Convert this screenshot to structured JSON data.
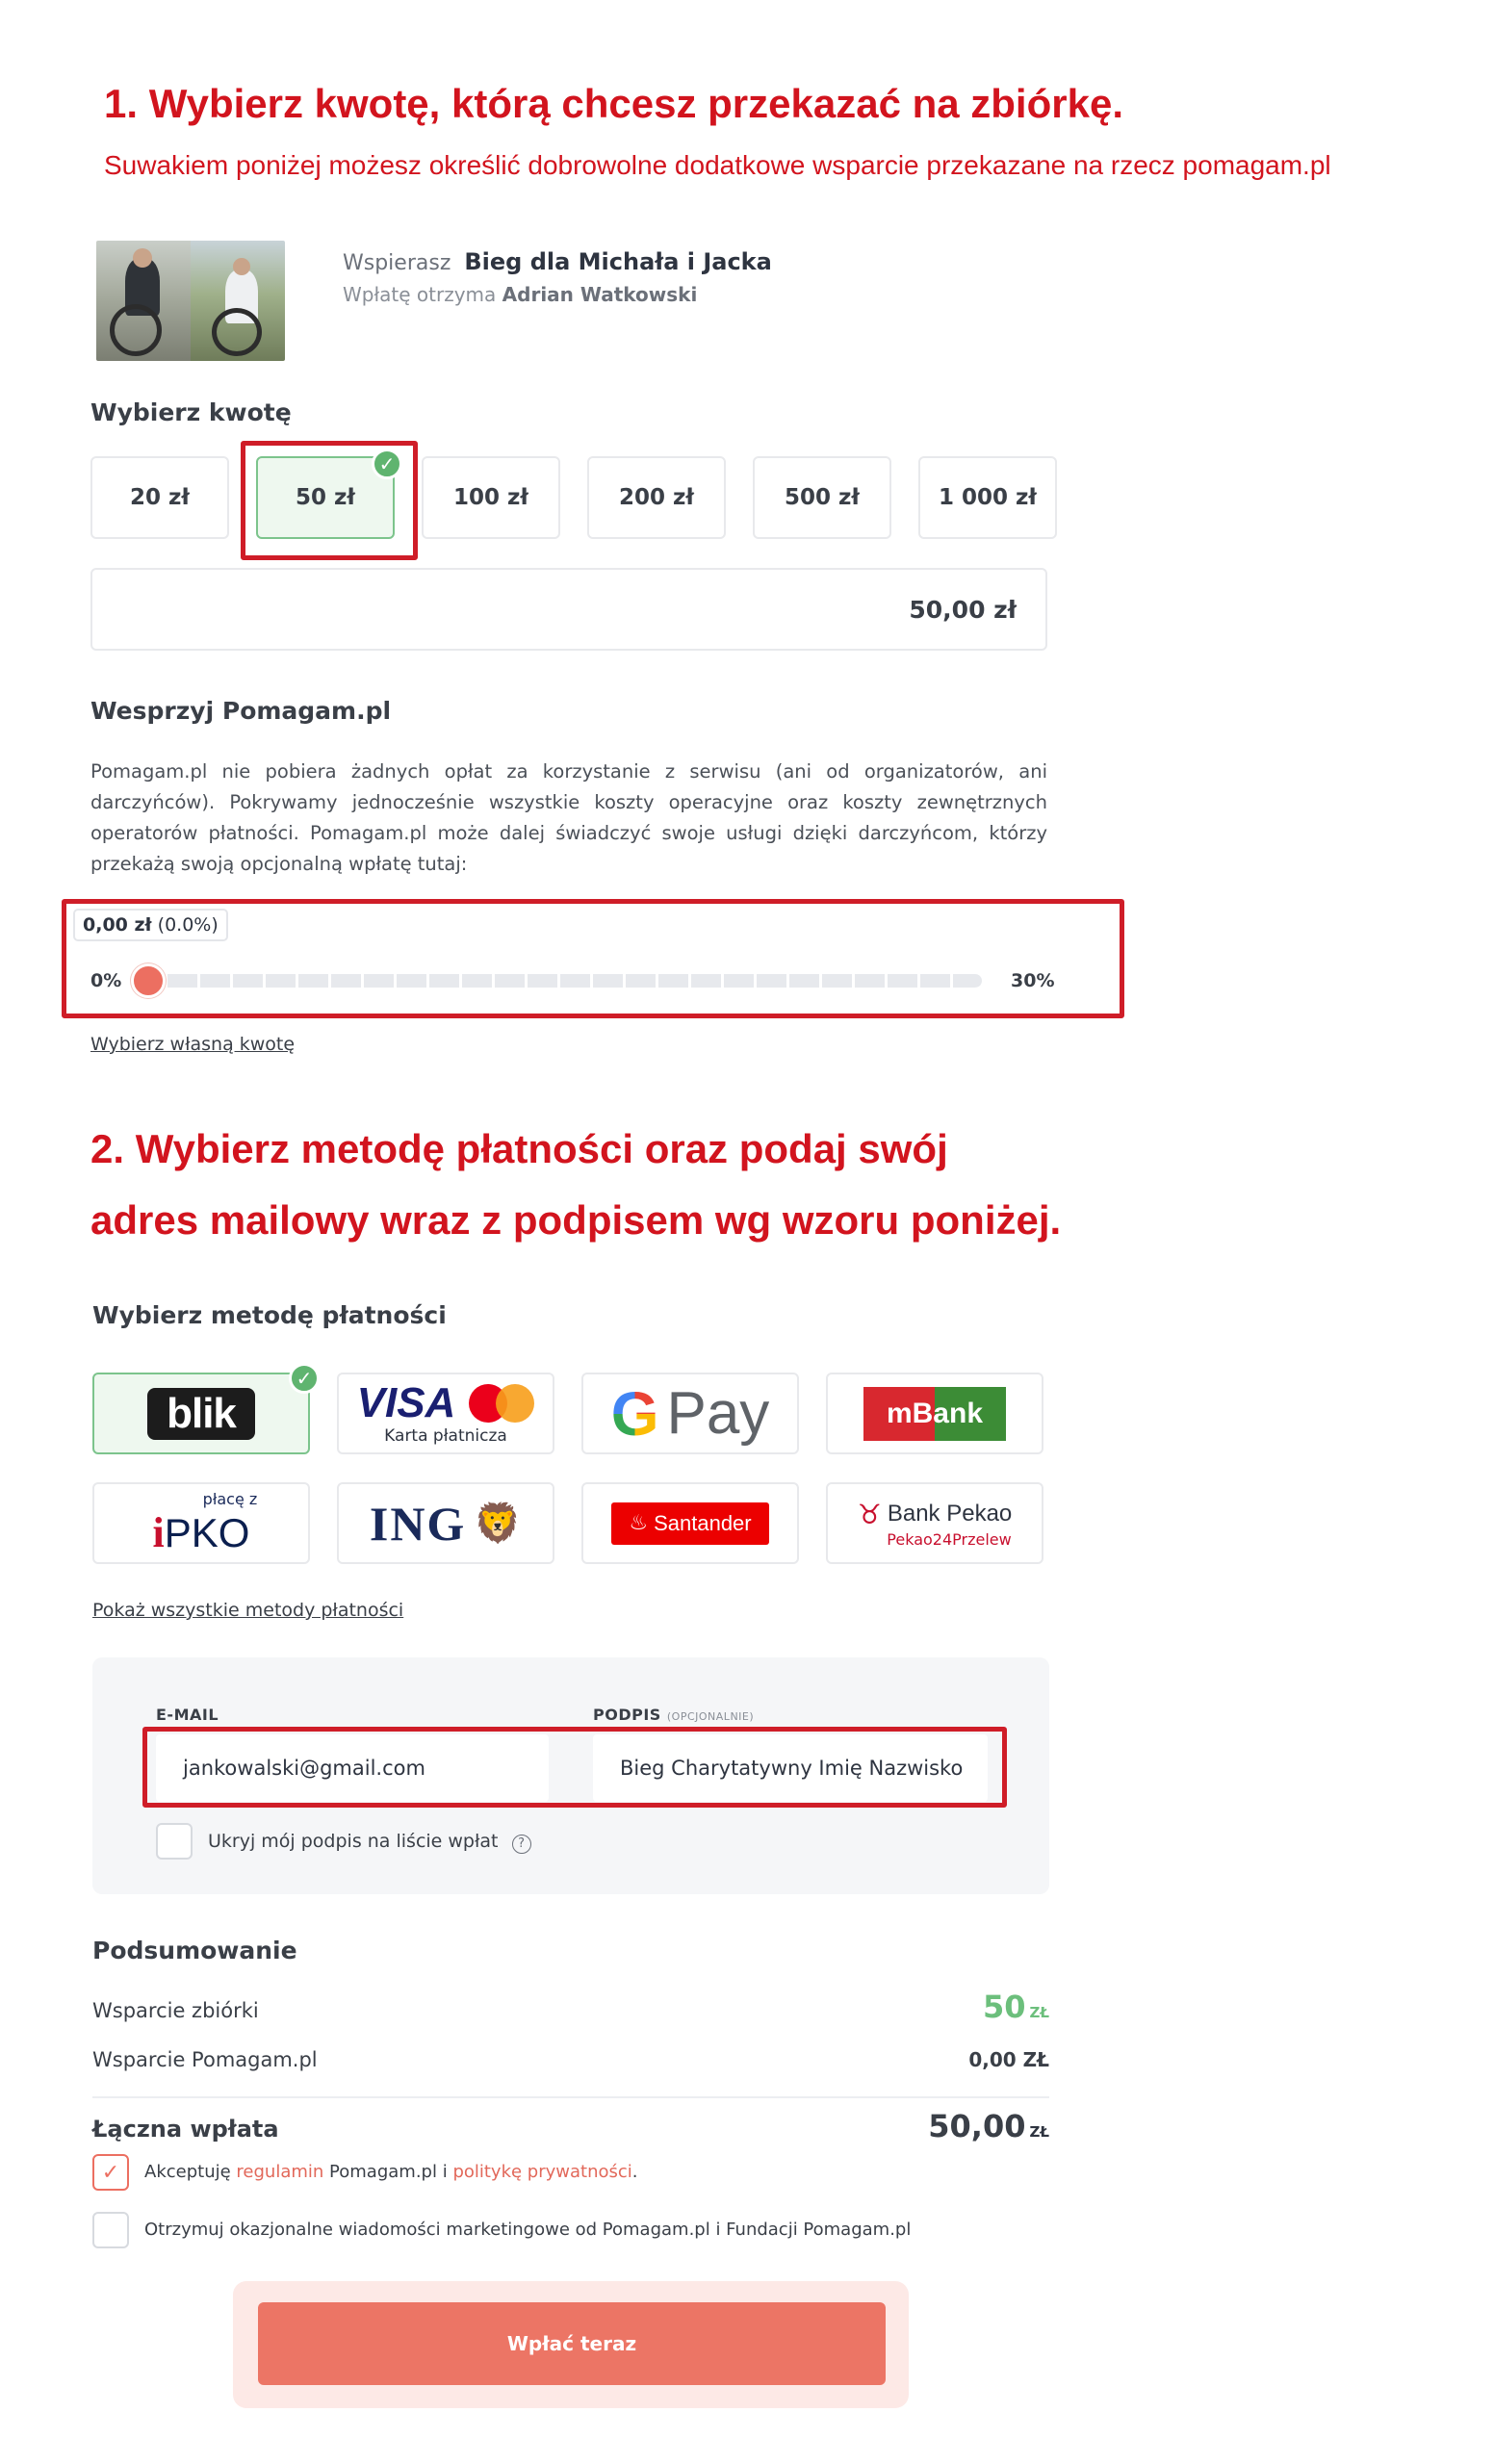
{
  "step1": {
    "title": "1. Wybierz kwotę, którą chcesz przekazać na zbiórkę.",
    "subtitle": "Suwakiem poniżej możesz określić dobrowolne dodatkowe wsparcie przekazane na rzecz pomagam.pl"
  },
  "campaign": {
    "support_prefix": "Wspierasz",
    "name": "Bieg dla Michała i Jacka",
    "recipient_prefix": "Wpłatę otrzyma",
    "recipient": "Adrian Watkowski"
  },
  "amount": {
    "heading": "Wybierz kwotę",
    "options": [
      "20 zł",
      "50 zł",
      "100 zł",
      "200 zł",
      "500 zł",
      "1 000 zł"
    ],
    "selected": "50 zł",
    "value": "50,00 zł"
  },
  "platform_support": {
    "heading": "Wesprzyj Pomagam.pl",
    "description": "Pomagam.pl nie pobiera żadnych opłat za korzystanie z serwisu (ani od organizatorów, ani darczyńców). Pokrywamy jednocześnie wszystkie koszty operacyjne oraz koszty zewnętrznych operatorów płatności. Pomagam.pl może dalej świadczyć swoje usługi dzięki darczyńcom, którzy przekażą swoją opcjonalną wpłatę tutaj:",
    "slider_amount": "0,00 zł",
    "slider_percent": "(0.0%)",
    "slider_value_fraction": 0,
    "min_label": "0%",
    "max_label": "30%",
    "custom_link": "Wybierz własną kwotę"
  },
  "step2": {
    "line1": "2. Wybierz metodę płatności oraz podaj swój",
    "line2": "adres mailowy wraz z podpisem wg wzoru poniżej."
  },
  "payment": {
    "heading": "Wybierz metodę płatności",
    "methods": {
      "blik": "blik",
      "visa": "VISA",
      "visa_caption": "Karta płatnicza",
      "gpay_pay": "Pay",
      "mbank": "mBank",
      "ipko_top": "płacę z",
      "ipko": "PKO",
      "ing": "ING",
      "santander": "Santander",
      "pekao": "Bank Pekao",
      "pekao_caption": "Pekao24Przelew"
    },
    "selected": "blik",
    "show_all": "Pokaż wszystkie metody płatności"
  },
  "form": {
    "email_label": "E-MAIL",
    "email_value": "jankowalski@gmail.com",
    "signature_label": "PODPIS",
    "signature_optional": "(OPCJONALNIE)",
    "signature_value": "Bieg Charytatywny Imię Nazwisko",
    "hide_signature": "Ukryj mój podpis na liście wpłat"
  },
  "summary": {
    "heading": "Podsumowanie",
    "fundraiser_label": "Wsparcie zbiórki",
    "fundraiser_value": "50",
    "fundraiser_currency": "ZŁ",
    "platform_label": "Wsparcie Pomagam.pl",
    "platform_value": "0,00 ZŁ",
    "total_label": "Łączna wpłata",
    "total_value": "50,00",
    "total_currency": "ZŁ"
  },
  "consents": {
    "terms_prefix": "Akceptuję",
    "terms_link": "regulamin",
    "terms_mid": "Pomagam.pl i",
    "privacy_link": "politykę prywatności",
    "terms_suffix": ".",
    "marketing": "Otrzymuj okazjonalne wiadomości marketingowe od Pomagam.pl i Fundacji Pomagam.pl"
  },
  "cta": {
    "label": "Wpłać teraz"
  },
  "colors": {
    "accent": "#ec7565",
    "annotation_red": "#d2141e",
    "selected_green": "#5fb46f"
  }
}
